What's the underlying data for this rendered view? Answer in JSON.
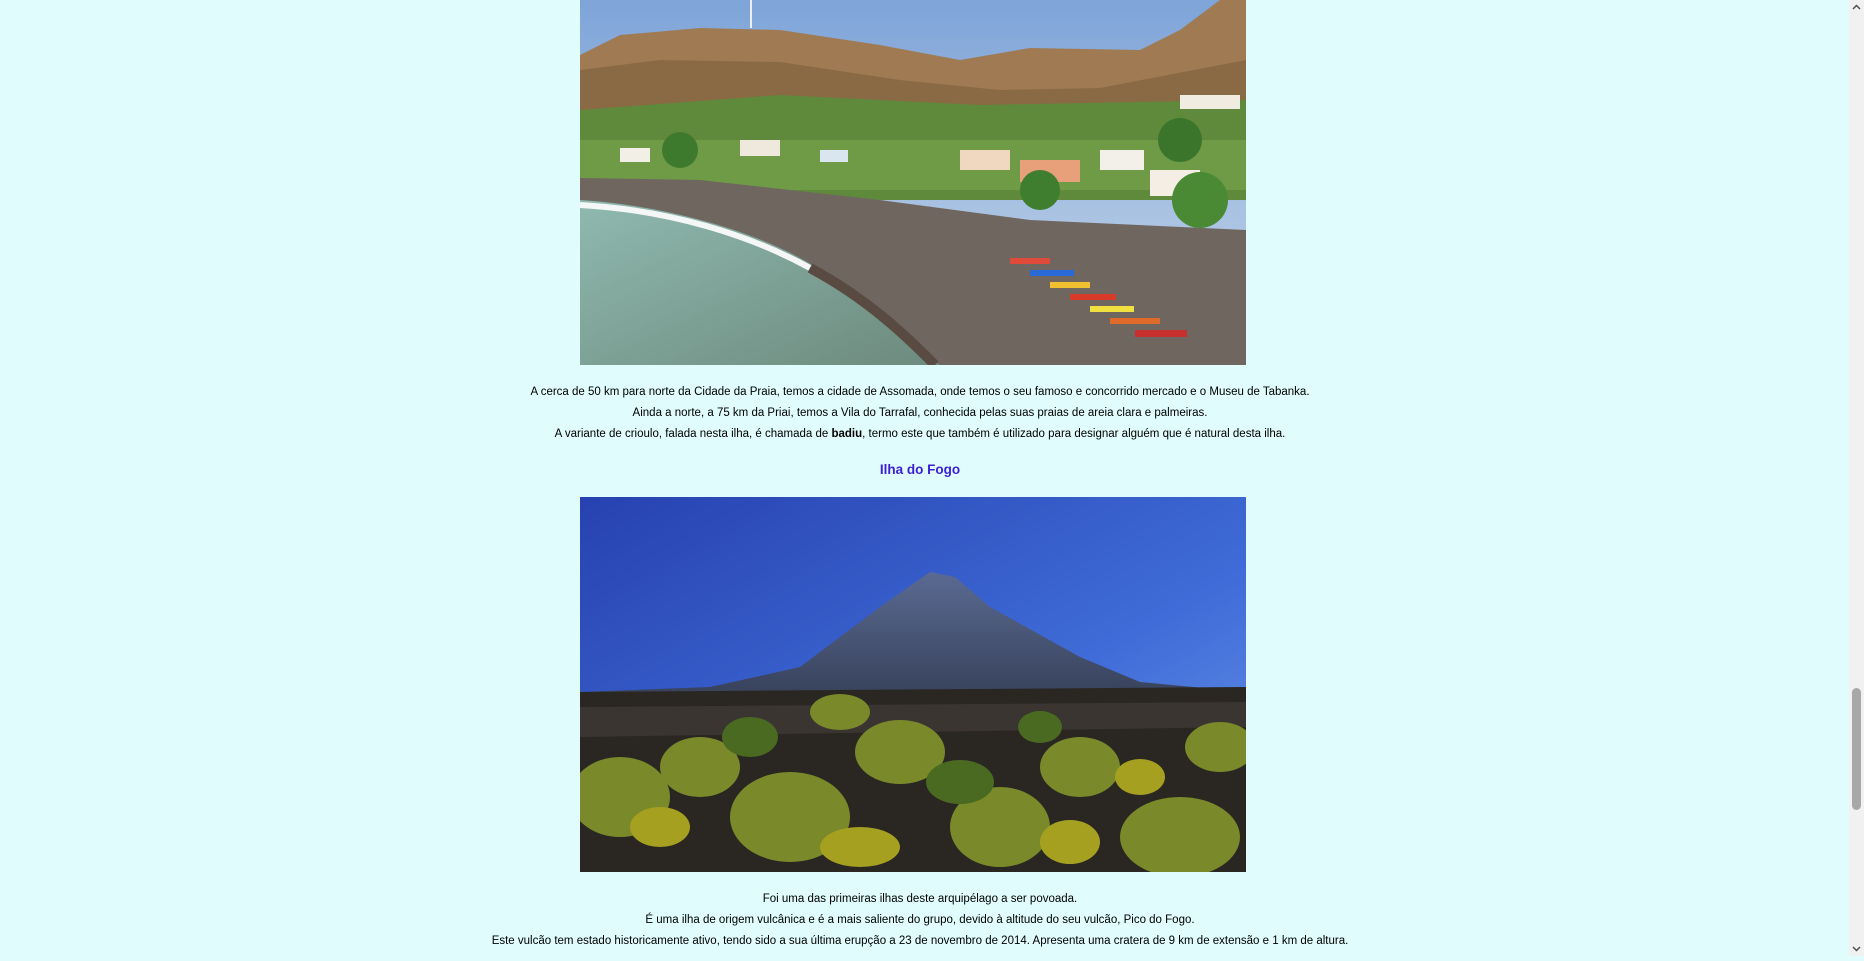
{
  "page": {
    "background": "#e0fcfc"
  },
  "santiago": {
    "image": "santiago-beach-photo",
    "paragraphs": [
      {
        "text": "A cerca de 50 km para norte da Cidade da Praia, temos a cidade de Assomada, onde temos o seu famoso e concorrido mercado e o Museu de Tabanka."
      },
      {
        "text": "Ainda a norte, a 75 km da Priai, temos a Vila do Tarrafal, conhecida pelas suas praias de areia clara e palmeiras."
      },
      {
        "before": "A variante de crioulo, falada nesta ilha, é chamada de ",
        "bold": "badiu",
        "after": ", termo este que também é utilizado para designar alguém que é natural desta ilha."
      }
    ]
  },
  "fogo": {
    "heading": "Ilha do Fogo",
    "heading_color": "#3b1fd6",
    "image": "fogo-volcano-photo",
    "paragraphs": [
      "Foi uma das primeiras ilhas deste arquipélago a ser povoada.",
      "É uma ilha de origem vulcânica e é a mais saliente do grupo, devido à altitude do seu vulcão, Pico do Fogo.",
      "Este vulcão tem estado historicamente ativo, tendo sido a sua última erupção a 23 de novembro de 2014. Apresenta uma cratera de 9 km de extensão e 1 km de altura."
    ]
  },
  "scrollbar": {
    "position_fraction": 0.78
  }
}
